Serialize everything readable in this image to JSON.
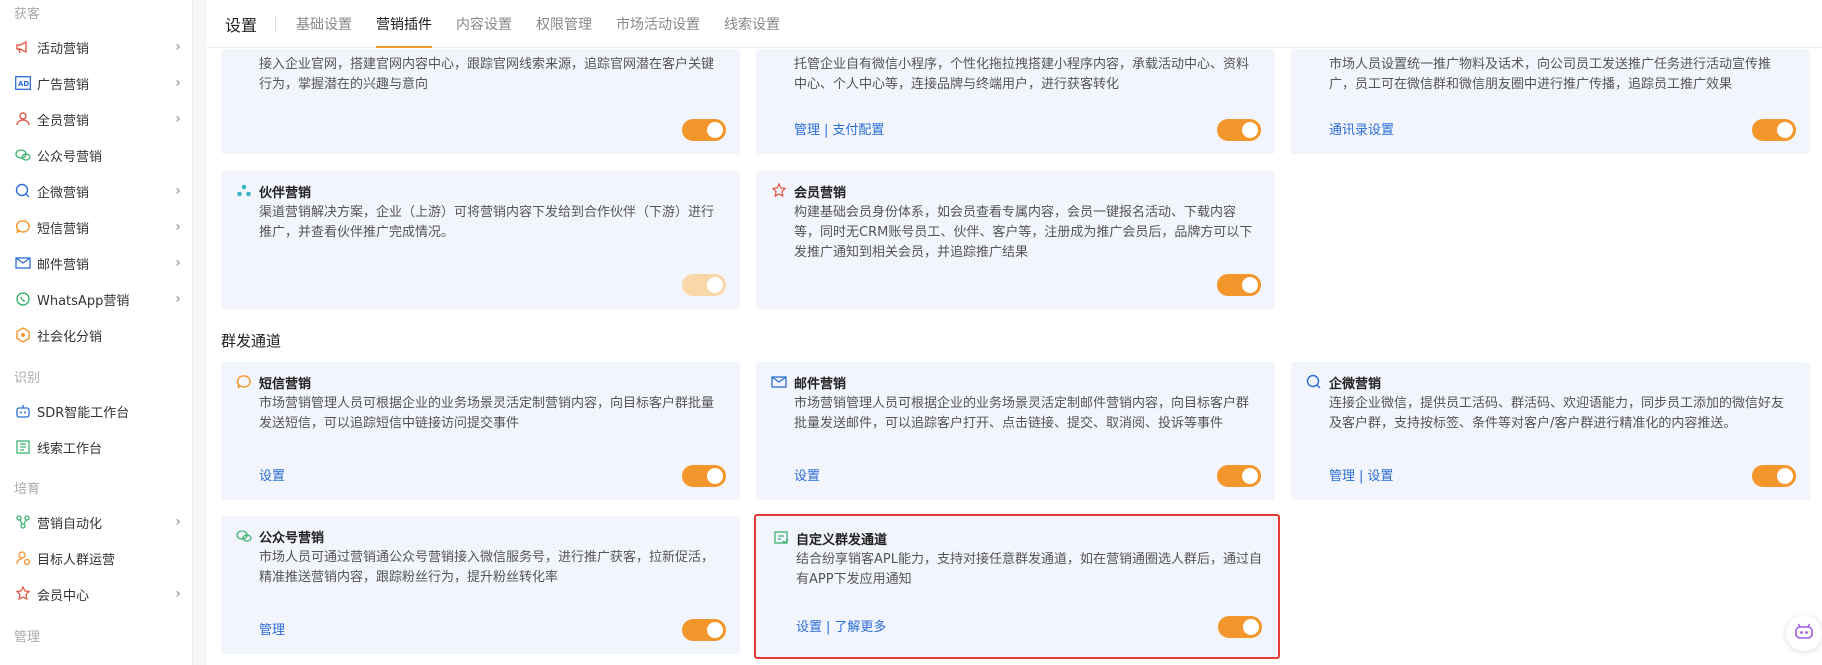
{
  "sidebar": {
    "sections": {
      "acquire": "获客",
      "identify": "识别",
      "nurture": "培育",
      "manage": "管理"
    },
    "items": [
      {
        "label": "活动营销",
        "icon": "megaphone-icon",
        "chevron": true
      },
      {
        "label": "广告营销",
        "icon": "ad-icon",
        "chevron": true
      },
      {
        "label": "全员营销",
        "icon": "people-icon",
        "chevron": true
      },
      {
        "label": "公众号营销",
        "icon": "wechat-icon",
        "chevron": false
      },
      {
        "label": "企微营销",
        "icon": "wecom-icon",
        "chevron": true
      },
      {
        "label": "短信营销",
        "icon": "sms-icon",
        "chevron": true
      },
      {
        "label": "邮件营销",
        "icon": "mail-icon",
        "chevron": true
      },
      {
        "label": "WhatsApp营销",
        "icon": "whatsapp-icon",
        "chevron": true
      },
      {
        "label": "社会化分销",
        "icon": "hex-icon",
        "chevron": false
      },
      {
        "label": "SDR智能工作台",
        "icon": "robot-icon",
        "chevron": false
      },
      {
        "label": "线索工作台",
        "icon": "list-icon",
        "chevron": false
      },
      {
        "label": "营销自动化",
        "icon": "flow-icon",
        "chevron": true
      },
      {
        "label": "目标人群运营",
        "icon": "target-user-icon",
        "chevron": false
      },
      {
        "label": "会员中心",
        "icon": "member-icon",
        "chevron": true
      }
    ]
  },
  "header": {
    "title": "设置",
    "tabs": [
      "基础设置",
      "营销插件",
      "内容设置",
      "权限管理",
      "市场活动设置",
      "线索设置"
    ],
    "active_tab": "营销插件"
  },
  "cards_top": [
    {
      "desc": "接入企业官网，搭建官网内容中心，跟踪官网线索来源，追踪官网潜在客户关键行为，掌握潜在的兴趣与意向"
    },
    {
      "desc": "托管企业自有微信小程序，个性化拖拉拽搭建小程序内容，承载活动中心、资料中心、个人中心等，连接品牌与终端用户，进行获客转化",
      "link1": "管理",
      "link2": "支付配置"
    },
    {
      "desc": "市场人员设置统一推广物料及话术，向公司员工发送推广任务进行活动宣传推广，员工可在微信群和微信朋友圈中进行推广传播，追踪员工推广效果",
      "link1": "通讯录设置"
    }
  ],
  "cards_mid": [
    {
      "title": "伙伴营销",
      "desc": "渠道营销解决方案，企业（上游）可将营销内容下发给到合作伙伴（下游）进行推广，并查看伙伴推广完成情况。"
    },
    {
      "title": "会员营销",
      "desc": "构建基础会员身份体系，如会员查看专属内容，会员一键报名活动、下载内容等，同时无CRM账号员工、伙伴、客户等，注册成为推广会员后，品牌方可以下发推广通知到相关会员，并追踪推广结果"
    }
  ],
  "section_channels": "群发通道",
  "cards_channels": [
    {
      "title": "短信营销",
      "desc": "市场营销管理人员可根据企业的业务场景灵活定制营销内容，向目标客户群批量发送短信，可以追踪短信中链接访问提交事件",
      "link1": "设置"
    },
    {
      "title": "邮件营销",
      "desc": "市场营销管理人员可根据企业的业务场景灵活定制邮件营销内容，向目标客户群批量发送邮件，可以追踪客户打开、点击链接、提交、取消阅、投诉等事件",
      "link1": "设置"
    },
    {
      "title": "企微营销",
      "desc": "连接企业微信，提供员工活码、群活码、欢迎语能力，同步员工添加的微信好友及客户群，支持按标签、条件等对客户/客户群进行精准化的内容推送。",
      "link1": "管理",
      "link2": "设置"
    },
    {
      "title": "公众号营销",
      "desc": "市场人员可通过营销通公众号营销接入微信服务号，进行推广获客，拉新促活，精准推送营销内容，跟踪粉丝行为，提升粉丝转化率",
      "link1": "管理"
    },
    {
      "title": "自定义群发通道",
      "desc": "结合纷享销客APL能力，支持对接任意群发通道，如在营销通圈选人群后，通过自有APP下发应用通知",
      "link1": "设置",
      "link2": "了解更多"
    }
  ],
  "colors": {
    "accent": "#f3962b",
    "link": "#2c6dd5",
    "highlight": "#e53935"
  }
}
